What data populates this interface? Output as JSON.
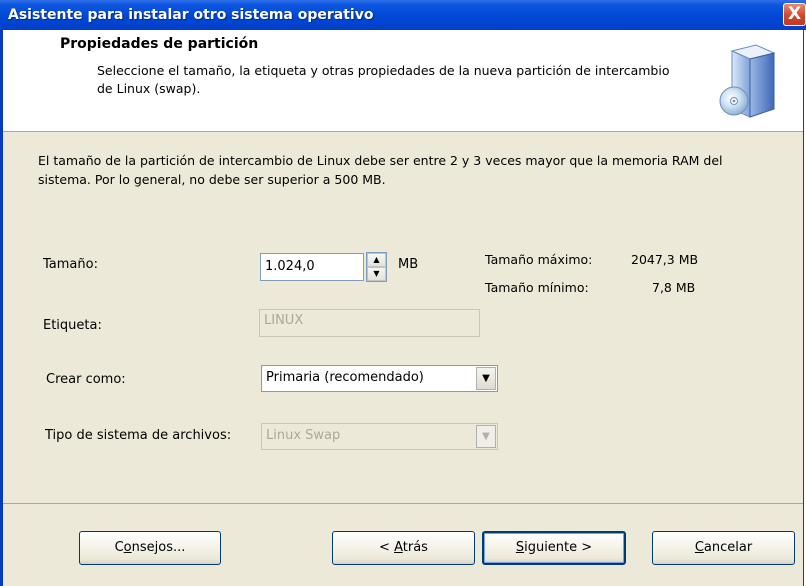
{
  "window": {
    "title": "Asistente para instalar otro sistema operativo",
    "close_glyph": "X"
  },
  "header": {
    "title": "Propiedades de partición",
    "subtitle": "Seleccione el tamaño, la etiqueta y otras propiedades de la nueva partición de intercambio de Linux (swap).",
    "icon": "disk-drive-cd-icon"
  },
  "description": "El tamaño de la partición de intercambio de Linux debe ser entre 2 y 3 veces mayor que la memoria RAM del sistema. Por lo general, no debe ser superior a 500 MB.",
  "form": {
    "size": {
      "label": "Tamaño:",
      "value": "1.024,0",
      "unit": "MB"
    },
    "max_size": {
      "label": "Tamaño máximo:",
      "value": "2047,3 MB"
    },
    "min_size": {
      "label": "Tamaño mínimo:",
      "value": "7,8 MB"
    },
    "tag": {
      "label": "Etiqueta:",
      "value": "LINUX"
    },
    "create_as": {
      "label": "Crear como:",
      "value": "Primaria (recomendado)"
    },
    "fs_type": {
      "label": "Tipo de sistema de archivos:",
      "value": "Linux Swap"
    }
  },
  "buttons": {
    "tips": {
      "pre": "C",
      "accel": "o",
      "post": "nsejos..."
    },
    "back": {
      "pre": "< ",
      "accel": "A",
      "post": "trás"
    },
    "next": {
      "pre": "",
      "accel": "S",
      "post": "iguiente >"
    },
    "cancel": {
      "pre": "",
      "accel": "C",
      "post": "ancelar"
    }
  },
  "colors": {
    "titlebar": "#0046d5",
    "dialog_bg": "#ece9d8",
    "close_button": "#d2472a"
  }
}
